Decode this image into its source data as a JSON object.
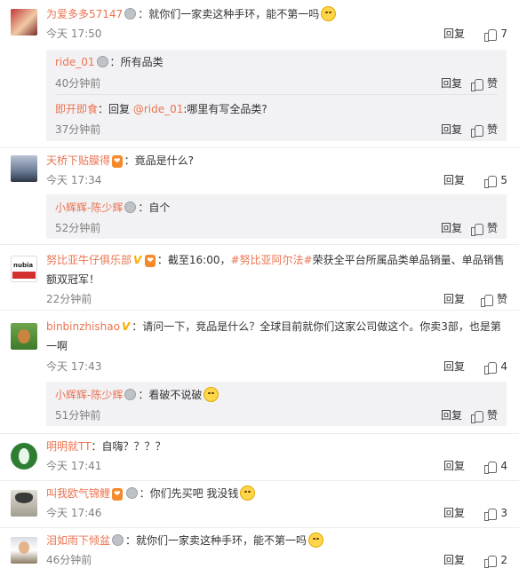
{
  "actions": {
    "reply": "回复",
    "like": "赞"
  },
  "comments": [
    {
      "user": "为爱多多57147",
      "sep": "：",
      "text": "就你们一家卖这种手环，能不第一吗",
      "time": "今天 17:50",
      "likes": "7",
      "replies": [
        {
          "user": "ride_01",
          "sep": "：",
          "text": "所有品类",
          "time": "40分钟前"
        },
        {
          "user": "即开即食",
          "sep": "：回复 ",
          "mention": "@ride_01",
          "text": ":哪里有写全品类?",
          "time": "37分钟前"
        }
      ]
    },
    {
      "user": "天桥下贴膜得",
      "sep": "：",
      "text": "竟品是什么?",
      "time": "今天 17:34",
      "likes": "5",
      "replies": [
        {
          "user": "小辉辉-陈少辉",
          "sep": "：",
          "text": "自个",
          "time": "52分钟前"
        }
      ]
    },
    {
      "user": "努比亚牛仔俱乐部",
      "sep": "：",
      "text_prefix": "截至16:00，",
      "topic": "#努比亚阿尔法#",
      "text": "荣获全平台所属品类单品销量、单品销售额双冠军！",
      "time": "22分钟前",
      "likes": "赞",
      "avatar_text": "nubia"
    },
    {
      "user": "binbinzhishao",
      "sep": "：",
      "text": "请问一下，竞品是什么？全球目前就你们这家公司做这个。你卖3部，也是第一啊",
      "time": "今天 17:43",
      "likes": "4",
      "replies": [
        {
          "user": "小辉辉-陈少辉",
          "sep": "：",
          "text": "看破不说破",
          "time": "51分钟前"
        }
      ]
    },
    {
      "user": "明明就TT",
      "sep": "：",
      "text": "自嗨？？？？",
      "time": "今天 17:41",
      "likes": "4"
    },
    {
      "user": "叫我欧气锦鲤",
      "sep": "：",
      "text": "你们先买吧 我没钱",
      "time": "今天 17:46",
      "likes": "3"
    },
    {
      "user": "泪如雨下倾盆",
      "sep": "：",
      "text": "就你们一家卖这种手环，能不第一吗",
      "time": "46分钟前",
      "likes": "2"
    }
  ],
  "colors": {
    "username": "#eb7350",
    "meta": "#808080",
    "reply_bg": "#f2f2f5"
  }
}
